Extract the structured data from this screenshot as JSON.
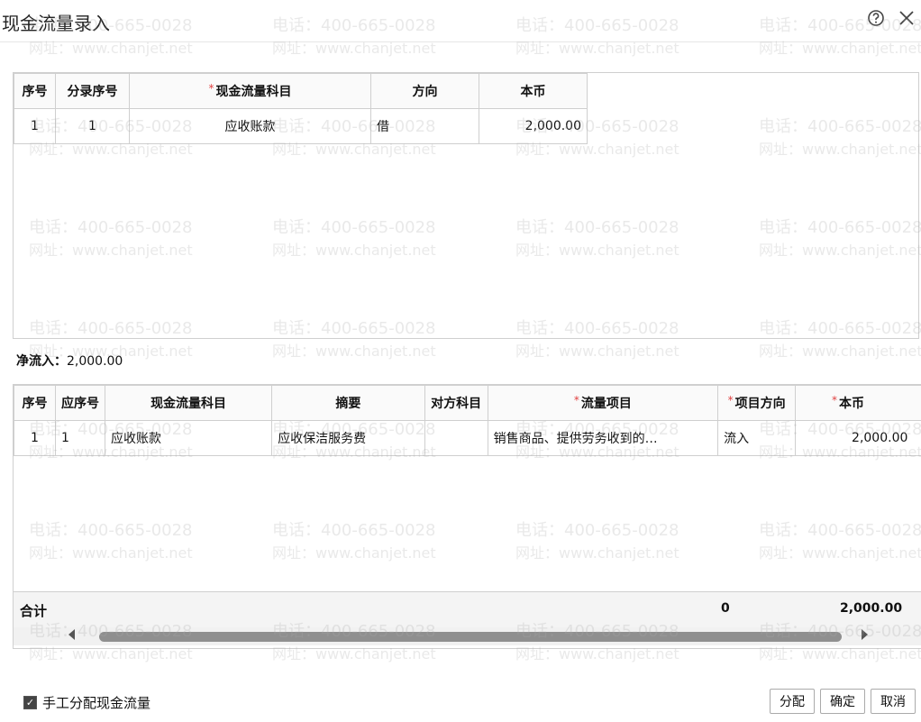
{
  "dialog": {
    "title": "现金流量录入",
    "help_icon": "help-circle-icon",
    "close_icon": "close-icon"
  },
  "entries_table": {
    "headers": [
      "序号",
      "分录序号",
      "现金流量科目",
      "方向",
      "本币"
    ],
    "required_header": "现金流量科目",
    "rows": [
      {
        "seq": "1",
        "entry_seq": "1",
        "subject": "应收账款",
        "direction": "借",
        "amount": "2,000.00"
      }
    ]
  },
  "net_flow": {
    "label": "净流入：",
    "value": "2,000.00"
  },
  "allocation_table": {
    "headers": [
      "序号",
      "应序号",
      "现金流量科目",
      "摘要",
      "对方科目",
      "流量项目",
      "项目方向",
      "本币"
    ],
    "required_headers": [
      "流量项目",
      "项目方向",
      "本币"
    ],
    "rows": [
      {
        "seq": "1",
        "corr_seq": "1",
        "subject": "应收账款",
        "summary": "应收保洁服务费",
        "counter_subject": "",
        "flow_item": "销售商品、提供劳务收到的…",
        "item_direction": "流入",
        "amount": "2,000.00"
      }
    ],
    "total": {
      "label": "合计",
      "direction_total": "0",
      "amount_total": "2,000.00"
    }
  },
  "watermark": {
    "phone": "电话：400-665-0028",
    "website": "网址：www.chanjet.net"
  },
  "footer": {
    "manual_checkbox_label": "手工分配现金流量",
    "manual_checked": true,
    "buttons": {
      "allocate": "分配",
      "confirm": "确定",
      "cancel": "取消"
    }
  }
}
